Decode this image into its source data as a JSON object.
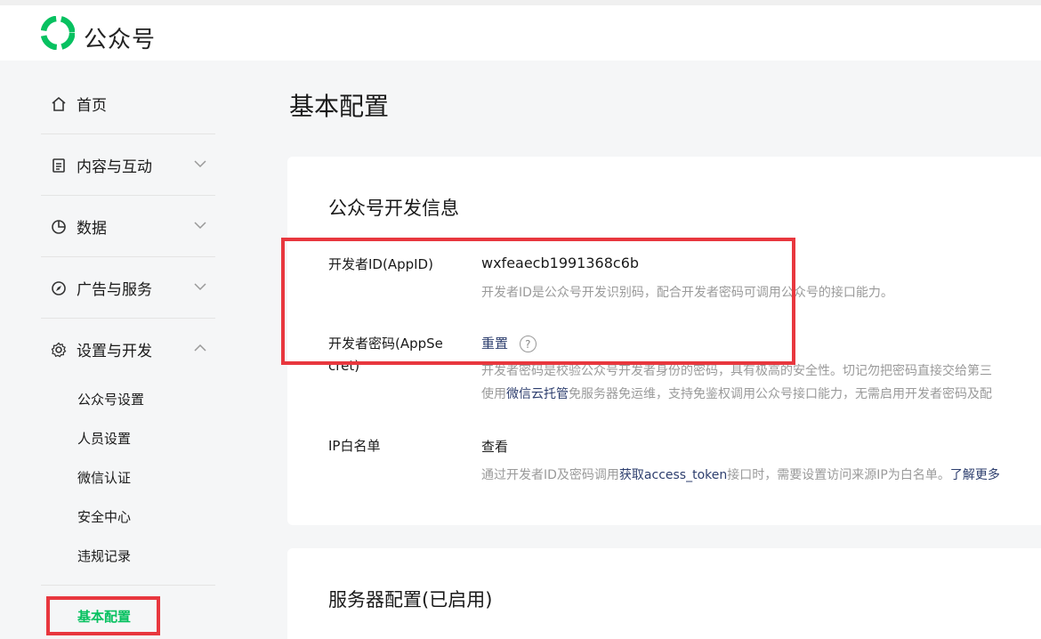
{
  "header": {
    "brand": "公众号"
  },
  "sidebar": {
    "items": [
      {
        "label": "首页",
        "icon": "home-icon"
      },
      {
        "label": "内容与互动",
        "icon": "document-icon"
      },
      {
        "label": "数据",
        "icon": "pie-chart-icon"
      },
      {
        "label": "广告与服务",
        "icon": "compass-icon"
      },
      {
        "label": "设置与开发",
        "icon": "gear-icon"
      }
    ],
    "sub_items": [
      "公众号设置",
      "人员设置",
      "微信认证",
      "安全中心",
      "违规记录"
    ],
    "active_sub": "基本配置"
  },
  "main": {
    "title": "基本配置",
    "dev_card": {
      "title": "公众号开发信息",
      "appid_label": "开发者ID(AppID)",
      "appid_value": "wxfeaecb1991368c6b",
      "appid_desc": "开发者ID是公众号开发识别码，配合开发者密码可调用公众号的接口能力。",
      "secret_label_1": "开发者密码(AppSe",
      "secret_label_2": "cret)",
      "secret_action": "重置",
      "secret_help": "?",
      "secret_desc_1": "开发者密码是校验公众号开发者身份的密码，具有极高的安全性。切记勿把密码直接交给第三",
      "secret_desc_2_prefix": "使用",
      "secret_desc_2_link": "微信云托管",
      "secret_desc_2_suffix": "免服务器免运维，支持免鉴权调用公众号接口能力，无需启用开发者密码及配",
      "ip_label": "IP白名单",
      "ip_action": "查看",
      "ip_desc_prefix": "通过开发者ID及密码调用",
      "ip_desc_link": "获取access_token",
      "ip_desc_suffix": "接口时，需要设置访问来源IP为白名单。",
      "ip_desc_more": "了解更多"
    },
    "server_card": {
      "title": "服务器配置(已启用)"
    }
  },
  "colors": {
    "accent": "#07c160",
    "highlight": "#e8373e",
    "link": "#576b95"
  }
}
